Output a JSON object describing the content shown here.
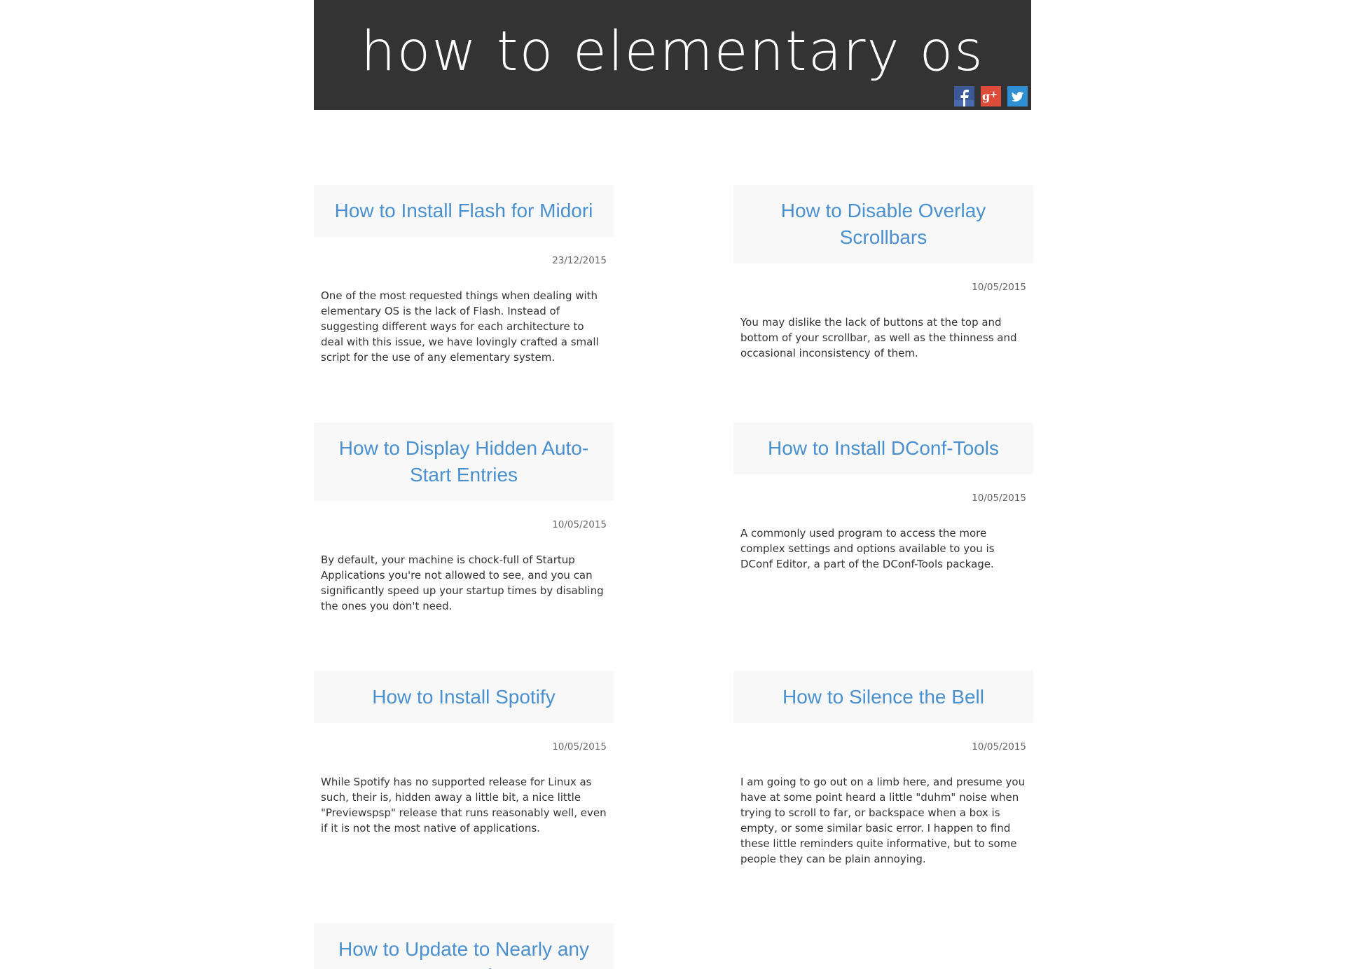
{
  "header": {
    "title": "how to elementary os",
    "social": [
      {
        "name": "facebook",
        "icon": "facebook-icon",
        "color": "#3b5998"
      },
      {
        "name": "google-plus",
        "icon": "google-plus-icon",
        "color": "#dd4b39"
      },
      {
        "name": "twitter",
        "icon": "twitter-icon",
        "color": "#2e8fd3"
      }
    ]
  },
  "colors": {
    "header_bg": "#333333",
    "link": "#4a90cf",
    "card_bg": "#f8f8f8"
  },
  "posts": [
    {
      "title": "How to Install Flash for Midori",
      "date": "23/12/2015",
      "excerpt": "One of the most requested things when dealing with elementary OS is the lack of Flash. Instead of suggesting different ways for each architecture to deal with this issue, we have lovingly crafted a small script for the use of any elementary system."
    },
    {
      "title": "How to Disable Overlay Scrollbars",
      "date": "10/05/2015",
      "excerpt": "You may dislike the lack of buttons at the top and bottom of your scrollbar, as well as the thinness and occasional inconsistency of them."
    },
    {
      "title": "How to Display Hidden Auto-Start Entries",
      "date": "10/05/2015",
      "excerpt": "By default, your machine is chock-full of Startup Applications you're not allowed to see, and you can significantly speed up your startup times by disabling the ones you don't need."
    },
    {
      "title": "How to Install DConf-Tools",
      "date": "10/05/2015",
      "excerpt": "A commonly used program to access the more complex settings and options available to you is DConf Editor, a part of the DConf-Tools package."
    },
    {
      "title": "How to Install Spotify",
      "date": "10/05/2015",
      "excerpt": "While Spotify has no supported release for Linux as such, their is, hidden away a little bit, a nice little \"Previewspsp\" release that runs reasonably well, even if it is not the most native of applications."
    },
    {
      "title": "How to Silence the Bell",
      "date": "10/05/2015",
      "excerpt": "I am going to go out on a limb here, and presume you have at some point heard a little \"duhm\" noise when trying to scroll to far, or backspace when a box is empty, or some similar basic error. I happen to find these little reminders quite informative, but to some people they can be plain annoying."
    },
    {
      "title": "How to Update to Nearly any Kernel",
      "date": "",
      "excerpt": ""
    }
  ]
}
